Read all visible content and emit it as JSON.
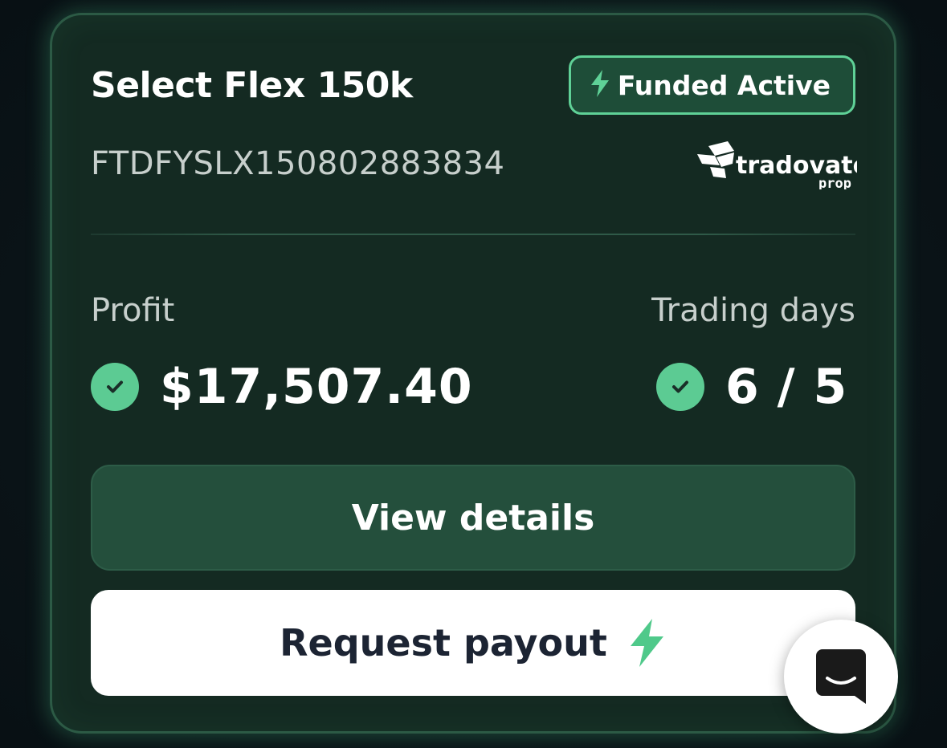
{
  "account": {
    "title": "Select Flex 150k",
    "id": "FTDFYSLX150802883834",
    "status_badge": "Funded Active",
    "broker_logo": {
      "name": "tradovate",
      "sub": "prop"
    }
  },
  "stats": {
    "profit_label": "Profit",
    "profit_value": "$17,507.40",
    "days_label": "Trading days",
    "days_value": "6 / 5"
  },
  "actions": {
    "view_details": "View details",
    "request_payout": "Request payout"
  },
  "colors": {
    "accent": "#5ccb93",
    "card_bg": "#142a22",
    "button_primary_bg": "#244f3c",
    "text_dark": "#1c2433"
  },
  "icons": {
    "badge": "lightning-bolt-icon",
    "check": "check-circle-icon",
    "payout": "lightning-bolt-icon",
    "chat": "chat-bubble-icon"
  }
}
